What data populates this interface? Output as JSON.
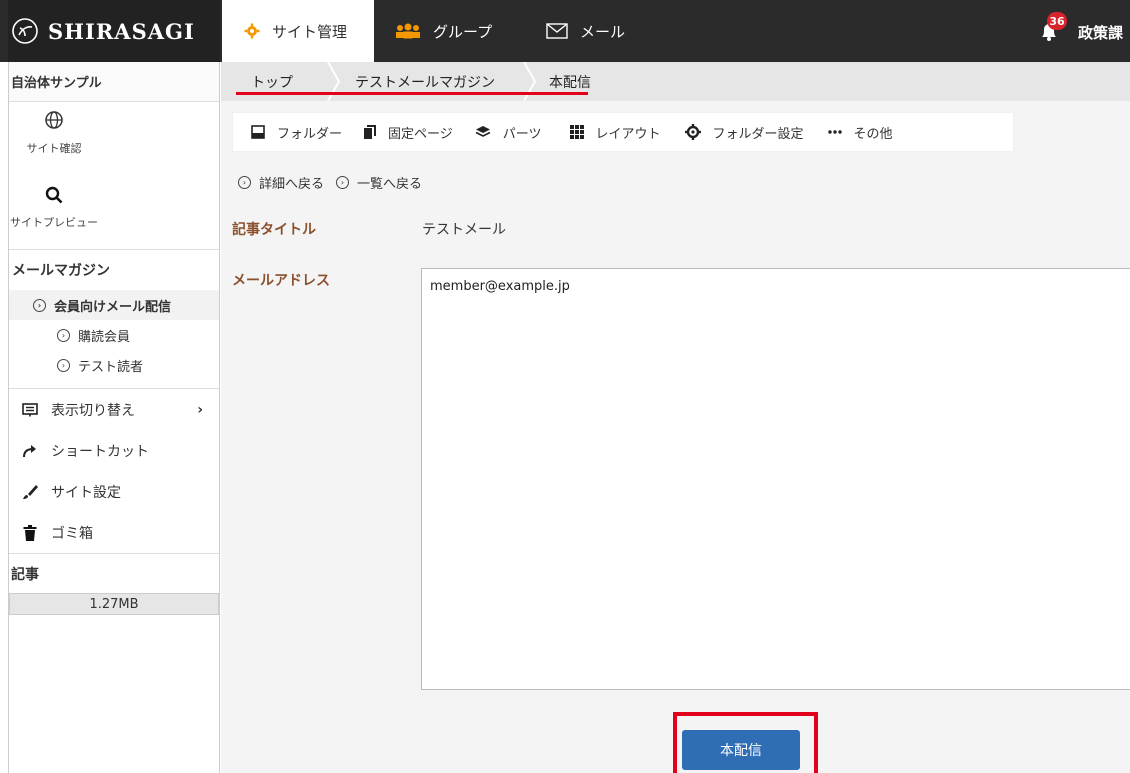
{
  "app": {
    "logo_text": "SHIRASAGI"
  },
  "header": {
    "tabs": [
      {
        "label": "サイト管理",
        "icon": "gear-icon",
        "active": true
      },
      {
        "label": "グループ",
        "icon": "users-icon",
        "active": false
      },
      {
        "label": "メール",
        "icon": "envelope-icon",
        "active": false
      }
    ],
    "notification_count": "36",
    "group_name": "政策課"
  },
  "sidebar": {
    "site_name": "自治体サンプル",
    "quick": [
      {
        "label": "サイト確認",
        "icon": "globe-icon"
      },
      {
        "label": "サイトプレビュー",
        "icon": "search-icon"
      }
    ],
    "section_title": "メールマガジン",
    "tree": [
      {
        "label": "会員向けメール配信",
        "level": 1
      },
      {
        "label": "購読会員",
        "level": 2
      },
      {
        "label": "テスト読者",
        "level": 2
      }
    ],
    "menu": [
      {
        "label": "表示切り替え",
        "icon": "display-icon",
        "chevron": "›"
      },
      {
        "label": "ショートカット",
        "icon": "share-arrow-icon"
      },
      {
        "label": "サイト設定",
        "icon": "brush-icon"
      },
      {
        "label": "ゴミ箱",
        "icon": "trash-icon"
      }
    ],
    "article_label": "記事",
    "usage": "1.27MB"
  },
  "breadcrumb": [
    "トップ",
    "テストメールマガジン",
    "本配信"
  ],
  "toolbar": [
    {
      "label": "フォルダー",
      "icon": "folder-icon"
    },
    {
      "label": "固定ページ",
      "icon": "page-icon"
    },
    {
      "label": "パーツ",
      "icon": "layers-icon"
    },
    {
      "label": "レイアウト",
      "icon": "grid-icon"
    },
    {
      "label": "フォルダー設定",
      "icon": "cog-icon"
    },
    {
      "label": "その他",
      "icon": "more-icon"
    }
  ],
  "back_links": [
    "詳細へ戻る",
    "一覧へ戻る"
  ],
  "form": {
    "title_label": "記事タイトル",
    "title_value": "テストメール",
    "address_label": "メールアドレス",
    "address_value": "member@example.jp"
  },
  "actions": {
    "send_label": "本配信"
  },
  "colors": {
    "header_bg": "#2b2b2b",
    "label_brown": "#8a4f2c",
    "primary_button": "#2f6db5",
    "highlight_red": "#e3001b",
    "badge_red": "#d9232d"
  }
}
